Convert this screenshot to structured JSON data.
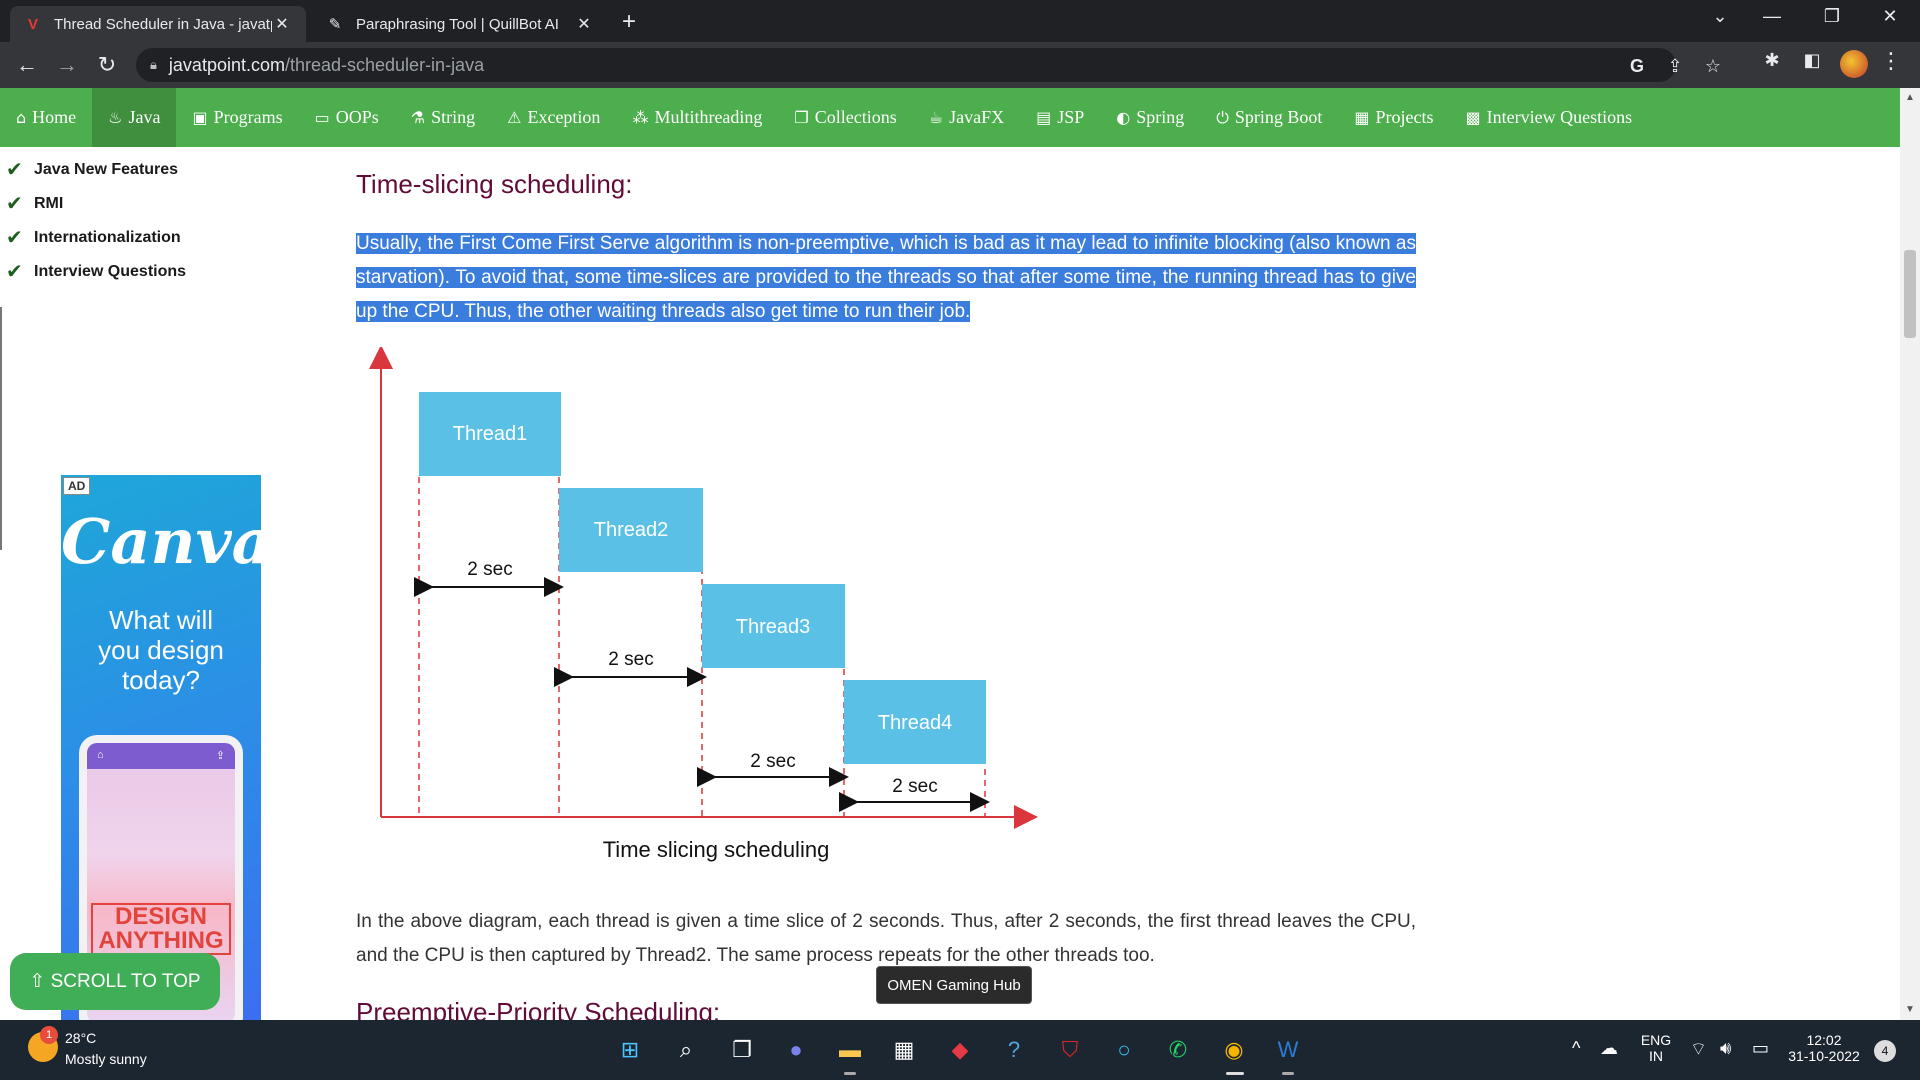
{
  "browser": {
    "tabs": [
      {
        "title": "Thread Scheduler in Java - javatp",
        "favicon": "V",
        "active": true
      },
      {
        "title": "Paraphrasing Tool | QuillBot AI",
        "favicon": "✎",
        "active": false
      }
    ],
    "url_host": "javatpoint.com",
    "url_path": "/thread-scheduler-in-java"
  },
  "site_nav": {
    "items": [
      {
        "label": "Home",
        "icon": "⌂"
      },
      {
        "label": "Java",
        "icon": "♨"
      },
      {
        "label": "Programs",
        "icon": "▣"
      },
      {
        "label": "OOPs",
        "icon": "▭"
      },
      {
        "label": "String",
        "icon": "⚗"
      },
      {
        "label": "Exception",
        "icon": "⚠"
      },
      {
        "label": "Multithreading",
        "icon": "⁂"
      },
      {
        "label": "Collections",
        "icon": "❐"
      },
      {
        "label": "JavaFX",
        "icon": "☕"
      },
      {
        "label": "JSP",
        "icon": "▤"
      },
      {
        "label": "Spring",
        "icon": "◐"
      },
      {
        "label": "Spring Boot",
        "icon": "⏻"
      },
      {
        "label": "Projects",
        "icon": "▦"
      },
      {
        "label": "Interview Questions",
        "icon": "▩"
      }
    ]
  },
  "sidebar": {
    "items": [
      {
        "label": "Java New Features"
      },
      {
        "label": "RMI"
      },
      {
        "label": "Internationalization"
      },
      {
        "label": "Interview Questions"
      }
    ]
  },
  "ad": {
    "badge": "AD",
    "logo": "Canva",
    "tagline_1": "What will",
    "tagline_2": "you design",
    "tagline_3": "today?",
    "design_1": "DESIGN",
    "design_2": "ANYTHING"
  },
  "scroll_to_top": "⇧ SCROLL TO TOP",
  "content": {
    "heading": "Time-slicing scheduling:",
    "para1": "Usually, the First Come First Serve algorithm is non-preemptive, which is bad as it may lead to infinite blocking (also known as starvation). To avoid that, some time-slices are provided to the threads so that after some time, the running thread has to give up the CPU. Thus, the other waiting threads also get time to run their job.",
    "para2": "In the above diagram, each thread is given a time slice of 2 seconds. Thus, after 2 seconds, the first thread leaves the CPU, and the CPU is then captured by Thread2. The same process repeats for the other threads too.",
    "next_heading": "Preemptive-Priority Scheduling:"
  },
  "diagram": {
    "threads": [
      "Thread1",
      "Thread2",
      "Thread3",
      "Thread4"
    ],
    "interval_label": "2 sec",
    "caption": "Time slicing scheduling",
    "block_color": "#5bc0e6",
    "axis_color": "#d9363e"
  },
  "tooltip": "OMEN Gaming Hub",
  "taskbar": {
    "weather_badge": "1",
    "temperature": "28°C",
    "weather": "Mostly sunny",
    "lang_1": "ENG",
    "lang_2": "IN",
    "time": "12:02",
    "date": "31-10-2022",
    "notifications": "4"
  }
}
